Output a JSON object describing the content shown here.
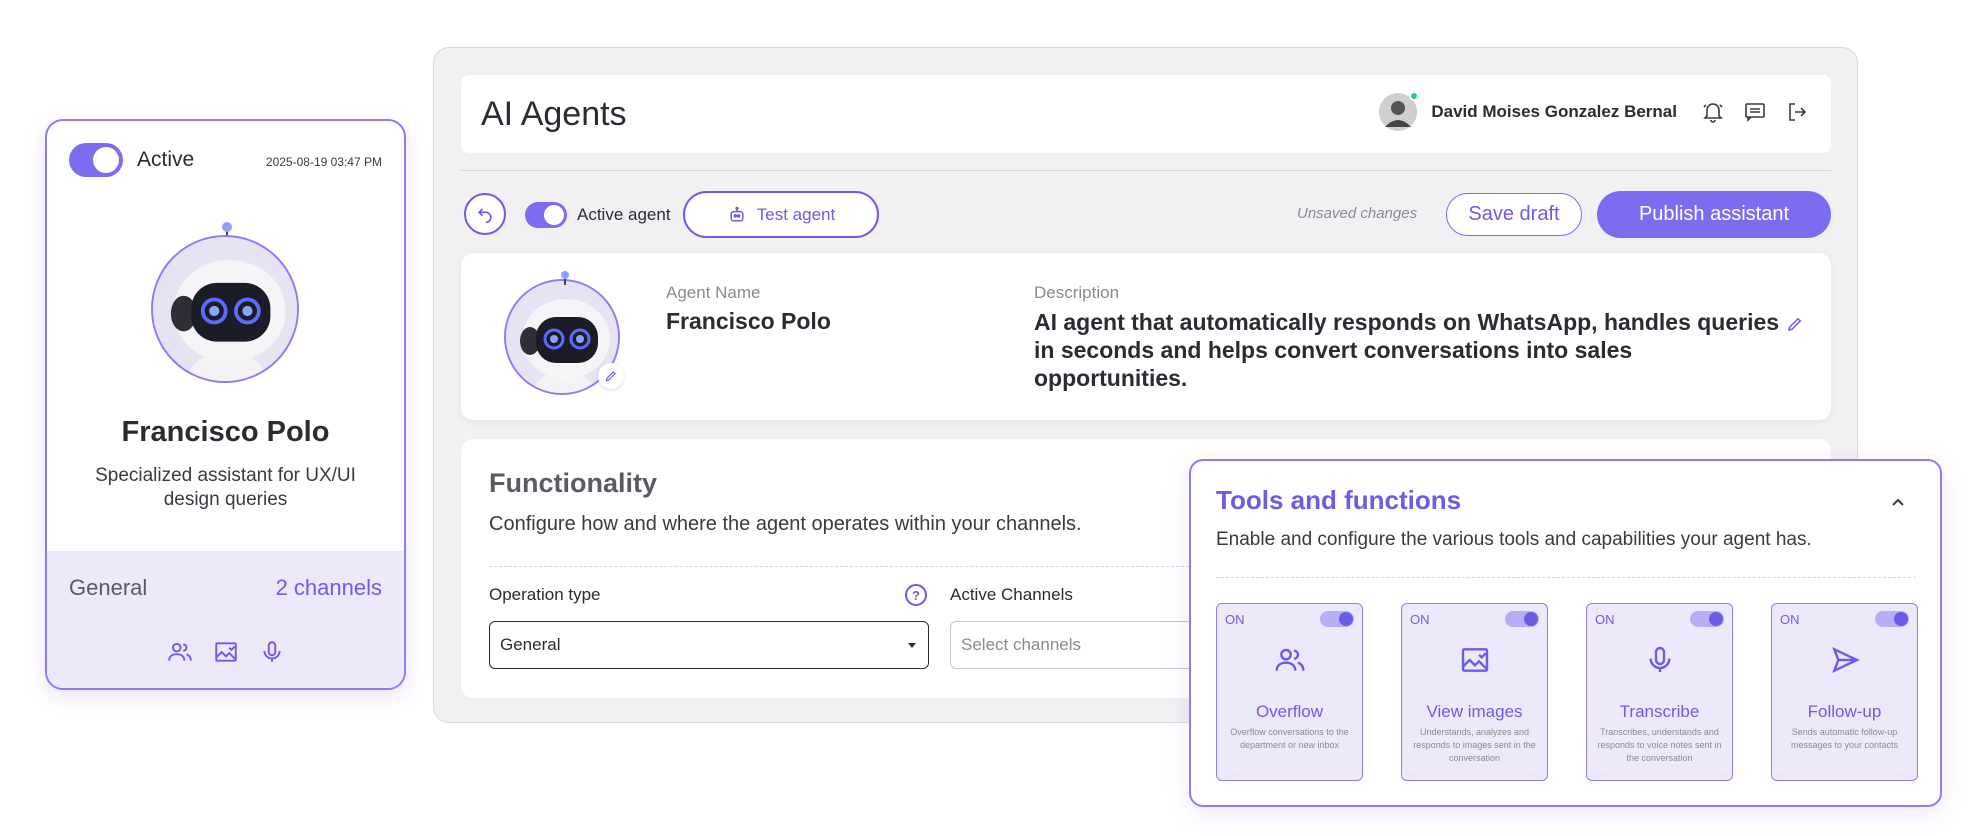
{
  "header": {
    "title": "AI Agents",
    "user_name": "David Moises Gonzalez Bernal"
  },
  "toolbar": {
    "active_agent_label": "Active agent",
    "test_agent_label": "Test agent",
    "unsaved_label": "Unsaved changes",
    "save_draft_label": "Save draft",
    "publish_label": "Publish assistant"
  },
  "agent": {
    "name_label": "Agent Name",
    "name": "Francisco Polo",
    "description_label": "Description",
    "description": "AI agent that automatically responds on WhatsApp, handles queries in seconds and helps convert conversations into sales opportunities."
  },
  "functionality": {
    "title": "Functionality",
    "subtitle": "Configure how and where the agent operates within your channels.",
    "operation_type_label": "Operation type",
    "operation_type_value": "General",
    "active_channels_label": "Active Channels",
    "active_channels_placeholder": "Select channels"
  },
  "profile_card": {
    "status": "Active",
    "date": "2025-08-19 03:47 PM",
    "name": "Francisco Polo",
    "description": "Specialized assistant for UX/UI design queries",
    "operation": "General",
    "channels": "2 channels",
    "icons": [
      "people-icon",
      "image-icon",
      "microphone-icon"
    ]
  },
  "tools": {
    "title": "Tools and functions",
    "subtitle": "Enable and configure the various tools and capabilities your agent has.",
    "items": [
      {
        "state": "ON",
        "name": "Overflow",
        "desc": "Overflow conversations to the department or new inbox",
        "icon": "people-icon"
      },
      {
        "state": "ON",
        "name": "View images",
        "desc": "Understands, analyzes and responds to images sent in the conversation",
        "icon": "image-icon"
      },
      {
        "state": "ON",
        "name": "Transcribe",
        "desc": "Transcribes, understands and responds to voice notes sent in the conversation",
        "icon": "microphone-icon"
      },
      {
        "state": "ON",
        "name": "Follow-up",
        "desc": "Sends automatic follow-up messages to your contacts",
        "icon": "send-icon"
      }
    ]
  },
  "colors": {
    "accent": "#7c6cf0",
    "accent_dark": "#6b5ce7",
    "accent_light": "#ece9fb",
    "online": "#2ecc71"
  }
}
